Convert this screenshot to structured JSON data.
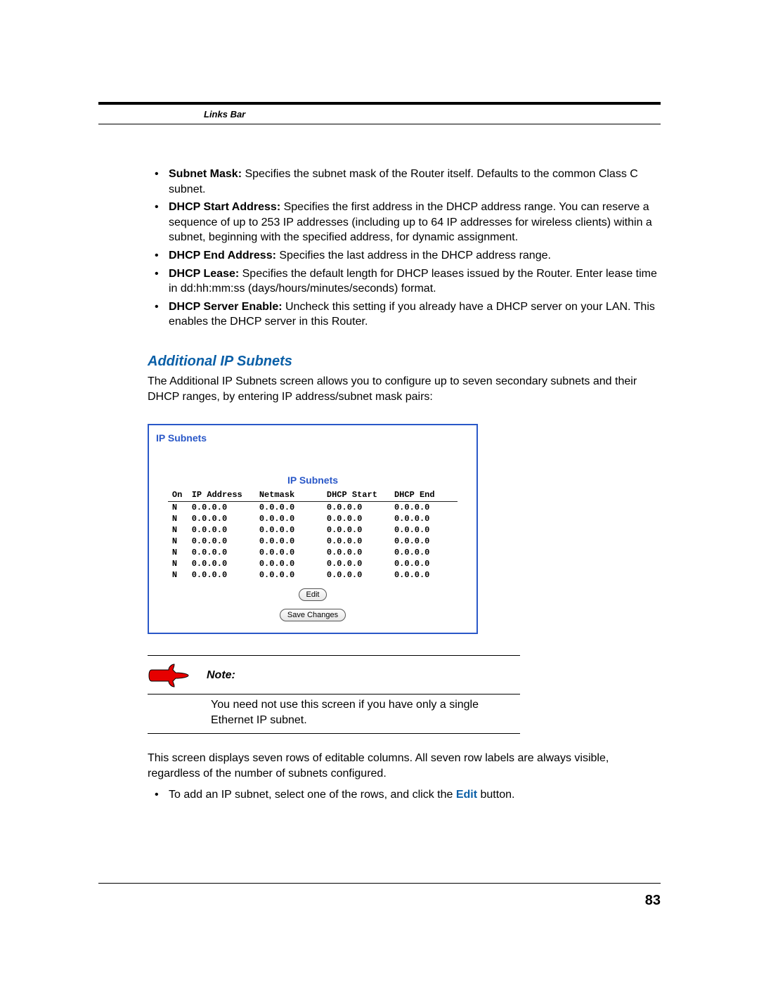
{
  "header": {
    "links_bar": "Links Bar"
  },
  "bullets1": [
    {
      "term": "Subnet Mask:",
      "text": " Specifies the subnet mask of the Router itself. Defaults to the common Class C subnet."
    },
    {
      "term": "DHCP Start Address:",
      "text": " Specifies the first address in the DHCP address range. You can reserve a sequence of up to 253 IP addresses (including up to 64 IP addresses for wireless clients) within a subnet, beginning with the specified address, for dynamic assignment."
    },
    {
      "term": "DHCP End Address:",
      "text": " Specifies the last address in the DHCP address range."
    },
    {
      "term": "DHCP Lease:",
      "text": " Specifies the default length for DHCP leases issued by the Router. Enter lease time in dd:hh:mm:ss (days/hours/minutes/seconds) format."
    },
    {
      "term": "DHCP Server Enable:",
      "text": " Uncheck this setting if you already have a DHCP server on your LAN. This enables the DHCP server in this Router."
    }
  ],
  "section": {
    "title": "Additional IP Subnets",
    "para": "The Additional IP Subnets screen allows you to configure up to seven secondary subnets and their DHCP ranges, by entering IP address/subnet mask pairs:"
  },
  "panel": {
    "outer_title": "IP Subnets",
    "inner_title": "IP Subnets",
    "headers": {
      "on": "On",
      "ip": "IP Address",
      "nm": "Netmask",
      "ds": "DHCP Start",
      "de": "DHCP End"
    },
    "rows": [
      {
        "on": "N",
        "ip": "0.0.0.0",
        "nm": "0.0.0.0",
        "ds": "0.0.0.0",
        "de": "0.0.0.0"
      },
      {
        "on": "N",
        "ip": "0.0.0.0",
        "nm": "0.0.0.0",
        "ds": "0.0.0.0",
        "de": "0.0.0.0"
      },
      {
        "on": "N",
        "ip": "0.0.0.0",
        "nm": "0.0.0.0",
        "ds": "0.0.0.0",
        "de": "0.0.0.0"
      },
      {
        "on": "N",
        "ip": "0.0.0.0",
        "nm": "0.0.0.0",
        "ds": "0.0.0.0",
        "de": "0.0.0.0"
      },
      {
        "on": "N",
        "ip": "0.0.0.0",
        "nm": "0.0.0.0",
        "ds": "0.0.0.0",
        "de": "0.0.0.0"
      },
      {
        "on": "N",
        "ip": "0.0.0.0",
        "nm": "0.0.0.0",
        "ds": "0.0.0.0",
        "de": "0.0.0.0"
      },
      {
        "on": "N",
        "ip": "0.0.0.0",
        "nm": "0.0.0.0",
        "ds": "0.0.0.0",
        "de": "0.0.0.0"
      }
    ],
    "edit_label": "Edit",
    "save_label": "Save Changes"
  },
  "note": {
    "label": "Note:",
    "text": "You need not use this screen if you have only a single Ethernet IP subnet."
  },
  "post_note": "This screen displays seven rows of editable columns. All seven row labels are always visible, regardless of the number of subnets configured.",
  "bullets2_prefix": "To add an IP subnet, select one of the rows, and click the ",
  "bullets2_link": "Edit",
  "bullets2_suffix": " button.",
  "page_number": "83"
}
